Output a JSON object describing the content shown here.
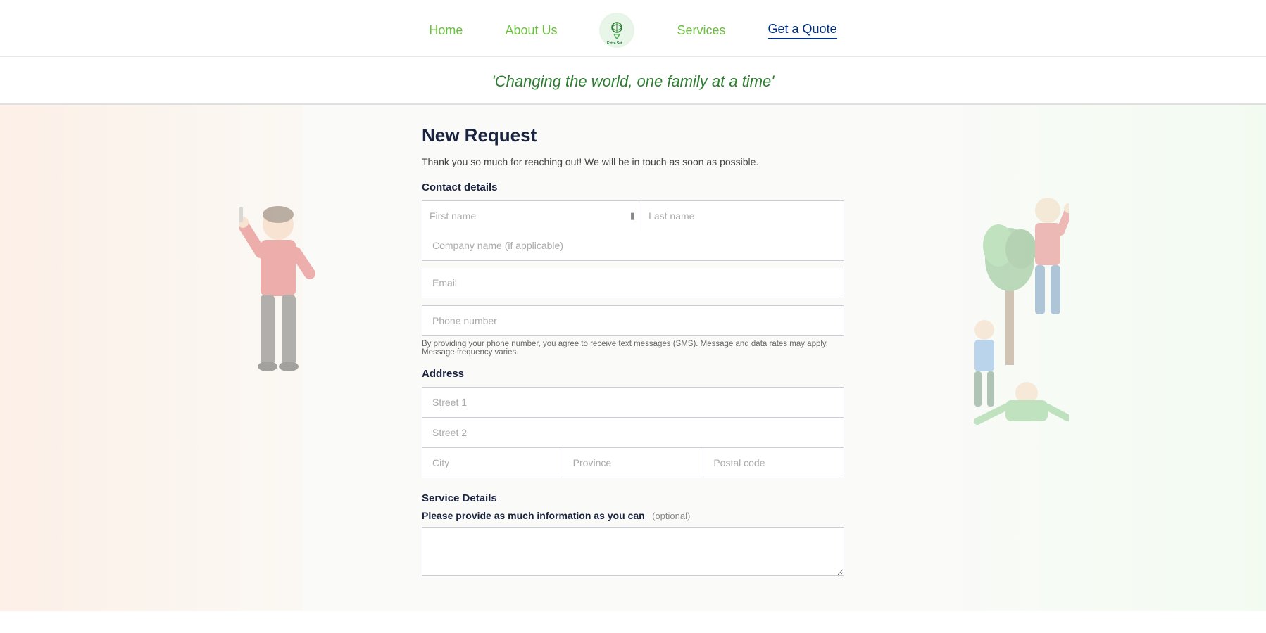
{
  "nav": {
    "home_label": "Home",
    "about_label": "About Us",
    "services_label": "Services",
    "quote_label": "Get a Quote",
    "logo_alt": "Extra Set of Hands"
  },
  "tagline": "'Changing the world, one family at a time'",
  "form": {
    "title": "New Request",
    "subtitle": "Thank you so much for reaching out! We will be in touch as soon as possible.",
    "contact_section": "Contact details",
    "first_name_placeholder": "First name",
    "last_name_placeholder": "Last name",
    "company_placeholder": "Company name (if applicable)",
    "email_placeholder": "Email",
    "phone_placeholder": "Phone number",
    "phone_note": "By providing your phone number, you agree to receive text messages (SMS). Message and data rates may apply. Message frequency varies.",
    "address_section": "Address",
    "street1_placeholder": "Street 1",
    "street2_placeholder": "Street 2",
    "city_placeholder": "City",
    "province_placeholder": "Province",
    "postal_placeholder": "Postal code",
    "service_section": "Service Details",
    "service_label": "Please provide as much information as you can",
    "service_optional": "(optional)"
  },
  "colors": {
    "nav_green": "#6abf3c",
    "nav_blue": "#003087",
    "tagline_green": "#2e7d32"
  }
}
